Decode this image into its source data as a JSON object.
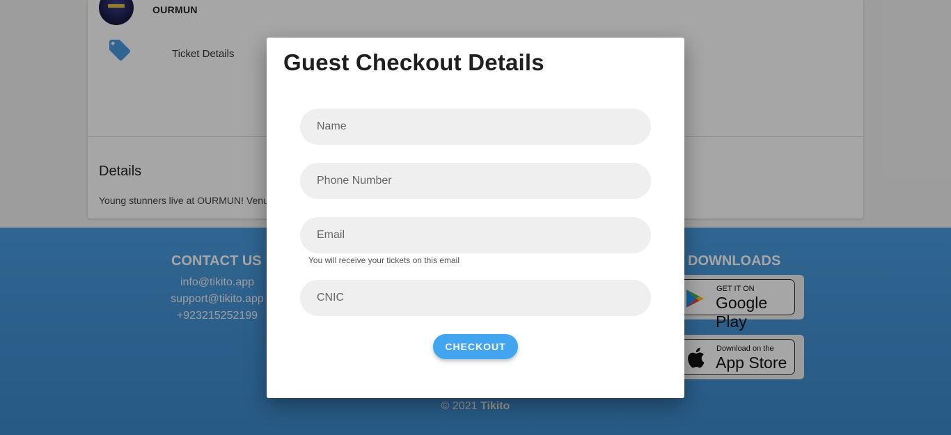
{
  "background": {
    "organizer_name": "OURMUN",
    "ticket_details_label": "Ticket Details",
    "details_title": "Details",
    "details_text": "Young stunners live at OURMUN! Venu"
  },
  "footer": {
    "contact_title": "CONTACT US",
    "contact_lines": [
      "info@tikito.app",
      "support@tikito.app",
      "+923215252199"
    ],
    "downloads_title": "DOWNLOADS",
    "google_play": {
      "small": "GET IT ON",
      "big": "Google Play"
    },
    "app_store": {
      "small": "Download on the",
      "big": "App Store"
    },
    "copyright_prefix": "© 2021",
    "copyright_brand": "Tikito"
  },
  "modal": {
    "title": "Guest Checkout Details",
    "fields": {
      "name_placeholder": "Name",
      "phone_placeholder": "Phone Number",
      "email_placeholder": "Email",
      "email_hint": "You will receive your tickets on this email",
      "cnic_placeholder": "CNIC"
    },
    "checkout_label": "CHECKOUT"
  },
  "colors": {
    "accent": "#42a5f0",
    "footer": "#4a9cdf",
    "tag_icon": "#4a9cdf"
  }
}
